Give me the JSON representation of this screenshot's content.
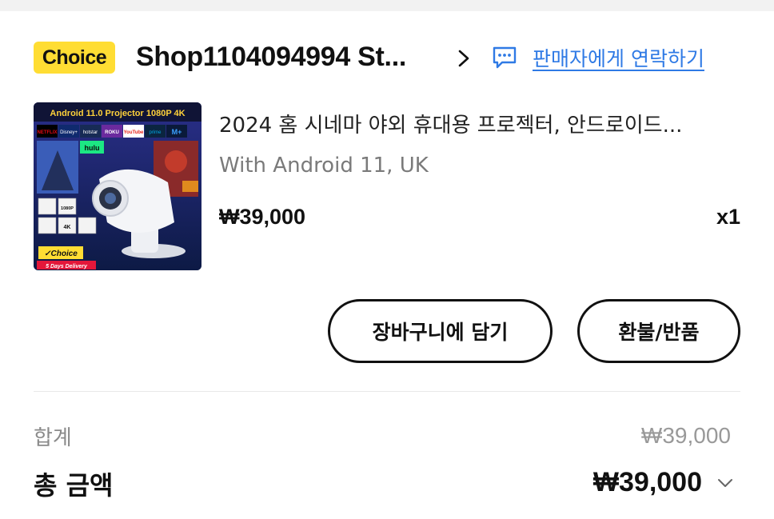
{
  "store": {
    "badge": "Choice",
    "name": "Shop1104094994 St...",
    "contact_label": "판매자에게 연락하기",
    "icons": {
      "chevron": "chevron-right-icon",
      "message": "chat-message-icon"
    }
  },
  "product": {
    "title": "2024 홈 시네마 야외 휴대용 프로젝터, 안드로이드...",
    "variant": "With Android 11, UK",
    "price": "₩39,000",
    "quantity": "x1",
    "thumbnail": {
      "banner": "Android 11.0 Projector 1080P 4K",
      "apps": [
        "NETFLIX",
        "Disney+",
        "hotstar",
        "ROKU",
        "YouTube",
        "prime",
        "M+",
        "hulu"
      ],
      "features": [
        "1080P",
        "4K"
      ],
      "badge": "✓Choice",
      "delivery": "5 Days Delivery"
    }
  },
  "actions": {
    "add_to_cart": "장바구니에 담기",
    "refund": "환불/반품"
  },
  "summary": {
    "subtotal_label": "합계",
    "subtotal_value": "₩39,000",
    "total_label": "총 금액",
    "total_value": "₩39,000",
    "expand_icon": "chevron-down-icon"
  },
  "colors": {
    "badge_bg": "#ffdd33",
    "link": "#2f7ae5",
    "text": "#111111",
    "muted": "#8a8a8a"
  }
}
